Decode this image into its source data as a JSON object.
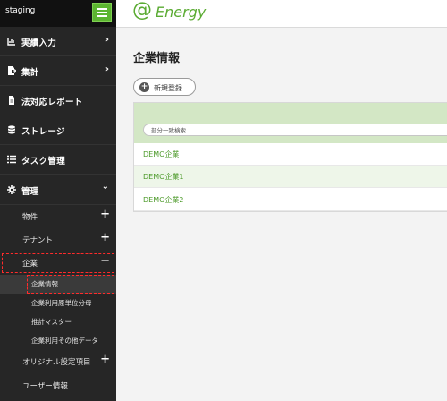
{
  "env": {
    "label": "staging"
  },
  "logo": {
    "text": "Energy",
    "at": "@"
  },
  "sidebar": {
    "items": [
      {
        "label": "実績入力",
        "icon": "chart-icon",
        "arrow": "›"
      },
      {
        "label": "集計",
        "icon": "export-file-icon",
        "arrow": "›"
      },
      {
        "label": "法対応レポート",
        "icon": "document-icon",
        "arrow": ""
      },
      {
        "label": "ストレージ",
        "icon": "database-icon",
        "arrow": ""
      },
      {
        "label": "タスク管理",
        "icon": "task-list-icon",
        "arrow": ""
      },
      {
        "label": "管理",
        "icon": "gear-icon",
        "arrow": "⌄"
      }
    ],
    "admin_items": [
      {
        "label": "物件",
        "toggle": "+"
      },
      {
        "label": "テナント",
        "toggle": "+"
      },
      {
        "label": "企業",
        "toggle": "−"
      }
    ],
    "company_sub_items": [
      {
        "label": "企業情報"
      },
      {
        "label": "企業利用原単位分母"
      },
      {
        "label": "推計マスター"
      },
      {
        "label": "企業利用その他データ"
      }
    ],
    "bottom_items": [
      {
        "label": "オリジナル設定項目",
        "toggle": "+"
      },
      {
        "label": "ユーザー情報",
        "toggle": ""
      }
    ]
  },
  "main": {
    "title": "企業情報",
    "new_button": "新規登録",
    "search_placeholder": "部分一致検索",
    "rows": [
      {
        "name": "DEMO企業"
      },
      {
        "name": "DEMO企業1"
      },
      {
        "name": "DEMO企業2"
      }
    ]
  },
  "colors": {
    "accent": "#5cb531",
    "sidebar": "#262626",
    "highlight": "#ff2b2b"
  }
}
